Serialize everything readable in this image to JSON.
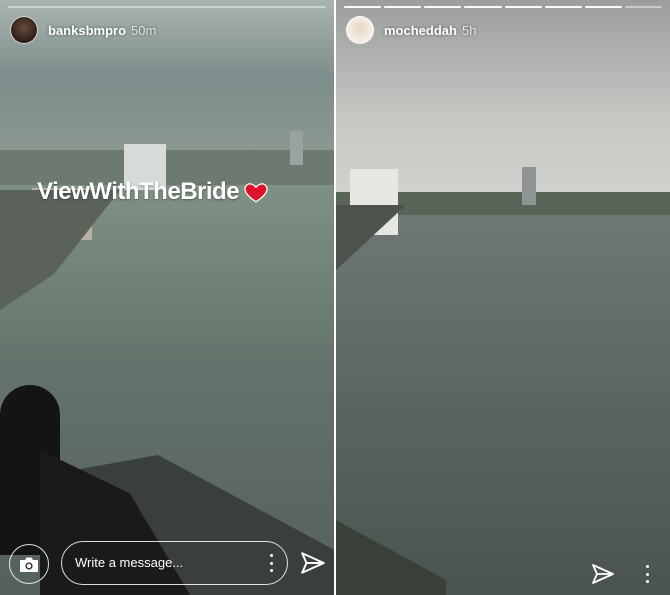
{
  "stories": [
    {
      "username": "banksbmpro",
      "time": "50m",
      "caption": "ViewWithTheBride",
      "caption_emoji": "heart-icon",
      "progress": {
        "segments": 1,
        "completed": 0
      },
      "message_placeholder": "Write a message...",
      "icons": [
        "camera-icon",
        "more-icon",
        "send-icon"
      ]
    },
    {
      "username": "mocheddah",
      "time": "5h",
      "progress": {
        "segments": 8,
        "completed": 7
      },
      "icons": [
        "send-icon",
        "more-icon"
      ]
    }
  ],
  "colors": {
    "heart": "#e0112a",
    "text": "#ffffff"
  }
}
